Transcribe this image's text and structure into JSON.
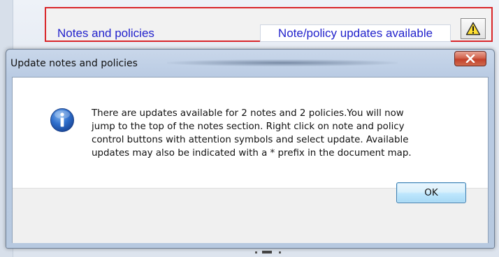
{
  "banner": {
    "title": "Notes and policies",
    "update_label": "Note/policy updates available",
    "warning_icon": "warning-triangle-icon"
  },
  "dialog": {
    "title": "Update notes and policies",
    "close_icon": "close-x-icon",
    "info_icon": "info-icon",
    "message_lines": [
      "There are updates available for 2 notes and 2 policies.You will now",
      "jump to the top of the notes section. Right click on note and policy",
      "control buttons with attention symbols and select update.  Available",
      "updates may also be indicated with a * prefix in the document map."
    ],
    "ok_label": "OK"
  },
  "colors": {
    "banner_border": "#d9262a",
    "banner_text": "#2222cc",
    "close_button": "#c3412b",
    "ok_button_border": "#3c7fb1"
  }
}
